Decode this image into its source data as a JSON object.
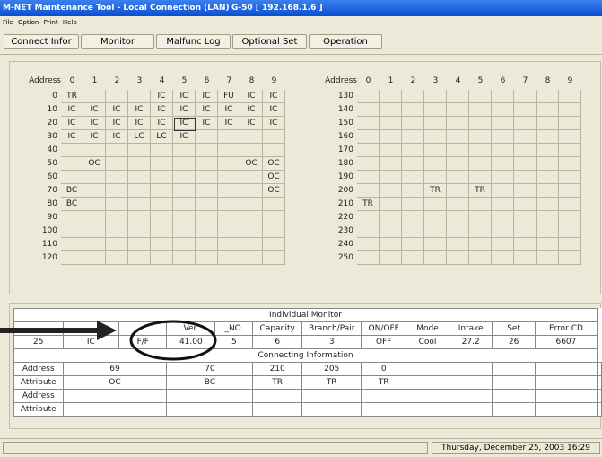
{
  "window": {
    "title": "M-NET Maintenance Tool - Local Connection (LAN)",
    "device": "G-50 [ 192.168.1.6 ]"
  },
  "menu": [
    "File",
    "Option",
    "Print",
    "Help"
  ],
  "toolbar": [
    "Connect Infor",
    "Monitor",
    "Malfunc Log",
    "Optional Set",
    "Operation"
  ],
  "left_grid": {
    "address_label": "Address",
    "cols": [
      "0",
      "1",
      "2",
      "3",
      "4",
      "5",
      "6",
      "7",
      "8",
      "9"
    ],
    "rows": [
      {
        "addr": "0",
        "cells": [
          "TR",
          "",
          "",
          "",
          "IC",
          "IC",
          "IC",
          "FU",
          "IC",
          "IC"
        ]
      },
      {
        "addr": "10",
        "cells": [
          "IC",
          "IC",
          "IC",
          "IC",
          "IC",
          "IC",
          "IC",
          "IC",
          "IC",
          "IC"
        ]
      },
      {
        "addr": "20",
        "cells": [
          "IC",
          "IC",
          "IC",
          "IC",
          "IC",
          "IC",
          "IC",
          "IC",
          "IC",
          "IC"
        ]
      },
      {
        "addr": "30",
        "cells": [
          "IC",
          "IC",
          "IC",
          "LC",
          "LC",
          "IC",
          "",
          "",
          "",
          ""
        ]
      },
      {
        "addr": "40",
        "cells": [
          "",
          "",
          "",
          "",
          "",
          "",
          "",
          "",
          "",
          ""
        ]
      },
      {
        "addr": "50",
        "cells": [
          "",
          "OC",
          "",
          "",
          "",
          "",
          "",
          "",
          "OC",
          "OC"
        ]
      },
      {
        "addr": "60",
        "cells": [
          "",
          "",
          "",
          "",
          "",
          "",
          "",
          "",
          "",
          "OC"
        ]
      },
      {
        "addr": "70",
        "cells": [
          "BC",
          "",
          "",
          "",
          "",
          "",
          "",
          "",
          "",
          "OC"
        ]
      },
      {
        "addr": "80",
        "cells": [
          "BC",
          "",
          "",
          "",
          "",
          "",
          "",
          "",
          "",
          ""
        ]
      },
      {
        "addr": "90",
        "cells": [
          "",
          "",
          "",
          "",
          "",
          "",
          "",
          "",
          "",
          ""
        ]
      },
      {
        "addr": "100",
        "cells": [
          "",
          "",
          "",
          "",
          "",
          "",
          "",
          "",
          "",
          ""
        ]
      },
      {
        "addr": "110",
        "cells": [
          "",
          "",
          "",
          "",
          "",
          "",
          "",
          "",
          "",
          ""
        ]
      },
      {
        "addr": "120",
        "cells": [
          "",
          "",
          "",
          "",
          "",
          "",
          "",
          "",
          "",
          ""
        ]
      }
    ]
  },
  "right_grid": {
    "address_label": "Address",
    "cols": [
      "0",
      "1",
      "2",
      "3",
      "4",
      "5",
      "6",
      "7",
      "8",
      "9"
    ],
    "rows": [
      {
        "addr": "130",
        "cells": [
          "",
          "",
          "",
          "",
          "",
          "",
          "",
          "",
          "",
          ""
        ]
      },
      {
        "addr": "140",
        "cells": [
          "",
          "",
          "",
          "",
          "",
          "",
          "",
          "",
          "",
          ""
        ]
      },
      {
        "addr": "150",
        "cells": [
          "",
          "",
          "",
          "",
          "",
          "",
          "",
          "",
          "",
          ""
        ]
      },
      {
        "addr": "160",
        "cells": [
          "",
          "",
          "",
          "",
          "",
          "",
          "",
          "",
          "",
          ""
        ]
      },
      {
        "addr": "170",
        "cells": [
          "",
          "",
          "",
          "",
          "",
          "",
          "",
          "",
          "",
          ""
        ]
      },
      {
        "addr": "180",
        "cells": [
          "",
          "",
          "",
          "",
          "",
          "",
          "",
          "",
          "",
          ""
        ]
      },
      {
        "addr": "190",
        "cells": [
          "",
          "",
          "",
          "",
          "",
          "",
          "",
          "",
          "",
          ""
        ]
      },
      {
        "addr": "200",
        "cells": [
          "",
          "",
          "",
          "TR",
          "",
          "TR",
          "",
          "",
          "",
          ""
        ]
      },
      {
        "addr": "210",
        "cells": [
          "TR",
          "",
          "",
          "",
          "",
          "",
          "",
          "",
          "",
          ""
        ]
      },
      {
        "addr": "220",
        "cells": [
          "",
          "",
          "",
          "",
          "",
          "",
          "",
          "",
          "",
          ""
        ]
      },
      {
        "addr": "230",
        "cells": [
          "",
          "",
          "",
          "",
          "",
          "",
          "",
          "",
          "",
          ""
        ]
      },
      {
        "addr": "240",
        "cells": [
          "",
          "",
          "",
          "",
          "",
          "",
          "",
          "",
          "",
          ""
        ]
      },
      {
        "addr": "250",
        "cells": [
          "",
          "",
          "",
          "",
          "",
          "",
          "",
          "",
          "",
          ""
        ]
      }
    ]
  },
  "individual_monitor": {
    "title": "Individual Monitor",
    "headers": [
      "",
      "",
      "",
      "Ver.",
      "_NO.",
      "Capacity",
      "Branch/Pair",
      "ON/OFF",
      "Mode",
      "Intake",
      "Set",
      "Error CD"
    ],
    "values": [
      "25",
      "IC",
      "F/F",
      "41.00",
      "5",
      "6",
      "3",
      "OFF",
      "Cool",
      "27.2",
      "26",
      "6607"
    ]
  },
  "connecting": {
    "title": "Connecting Information",
    "rows": [
      {
        "label": "Address",
        "values": [
          "69",
          "70",
          "210",
          "205",
          "0"
        ]
      },
      {
        "label": "Attribute",
        "values": [
          "OC",
          "BC",
          "TR",
          "TR",
          "TR"
        ]
      },
      {
        "label": "Address",
        "values": [
          "",
          "",
          "",
          "",
          ""
        ]
      },
      {
        "label": "Attribute",
        "values": [
          "",
          "",
          "",
          "",
          ""
        ]
      }
    ]
  },
  "status": {
    "datetime": "Thursday, December 25, 2003 16:29"
  }
}
